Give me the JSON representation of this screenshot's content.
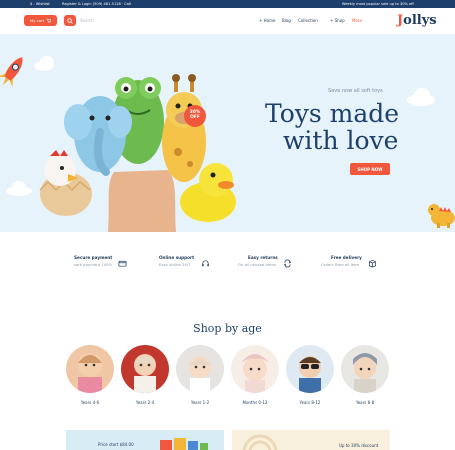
{
  "topbar": {
    "currency": "$ - Wishlist",
    "contact": "Register & Login  (509) 481-5128 · Call",
    "promo": "Weekly most popular sale up to 30% off"
  },
  "header": {
    "cart_label": "My cart",
    "search_placeholder": "Search",
    "nav": [
      "Home",
      "Blog",
      "Collection",
      "Shop",
      "More"
    ],
    "logo_initial": "J",
    "logo_rest": "ollys"
  },
  "hero": {
    "eyebrow": "Save now all soft toys",
    "title_line1": "Toys made",
    "title_line2": "with love",
    "cta": "SHOP NOW",
    "badge_percent": "30%",
    "badge_label": "OFF"
  },
  "features": [
    {
      "title": "Secure payment",
      "subtitle": "safe payment 100%",
      "icon": "card-icon"
    },
    {
      "title": "Online support",
      "subtitle": "Easy online 24/7",
      "icon": "headset-icon"
    },
    {
      "title": "Easy returns",
      "subtitle": "On all unused items",
      "icon": "return-icon"
    },
    {
      "title": "Free delivery",
      "subtitle": "Orders from all item",
      "icon": "box-icon"
    }
  ],
  "shop_by_age": {
    "title": "Shop by age",
    "items": [
      {
        "label": "Years 4-6"
      },
      {
        "label": "Years 2-4"
      },
      {
        "label": "Years 1-2"
      },
      {
        "label": "Months 0-12"
      },
      {
        "label": "Years 8-12"
      },
      {
        "label": "Years 6-8"
      }
    ]
  },
  "banners": {
    "left_text": "Price start $84.00",
    "right_text": "Up to 30% discount"
  },
  "colors": {
    "accent": "#f1573d",
    "navy": "#1d3f6b",
    "hero_bg": "#e7f3fb"
  }
}
